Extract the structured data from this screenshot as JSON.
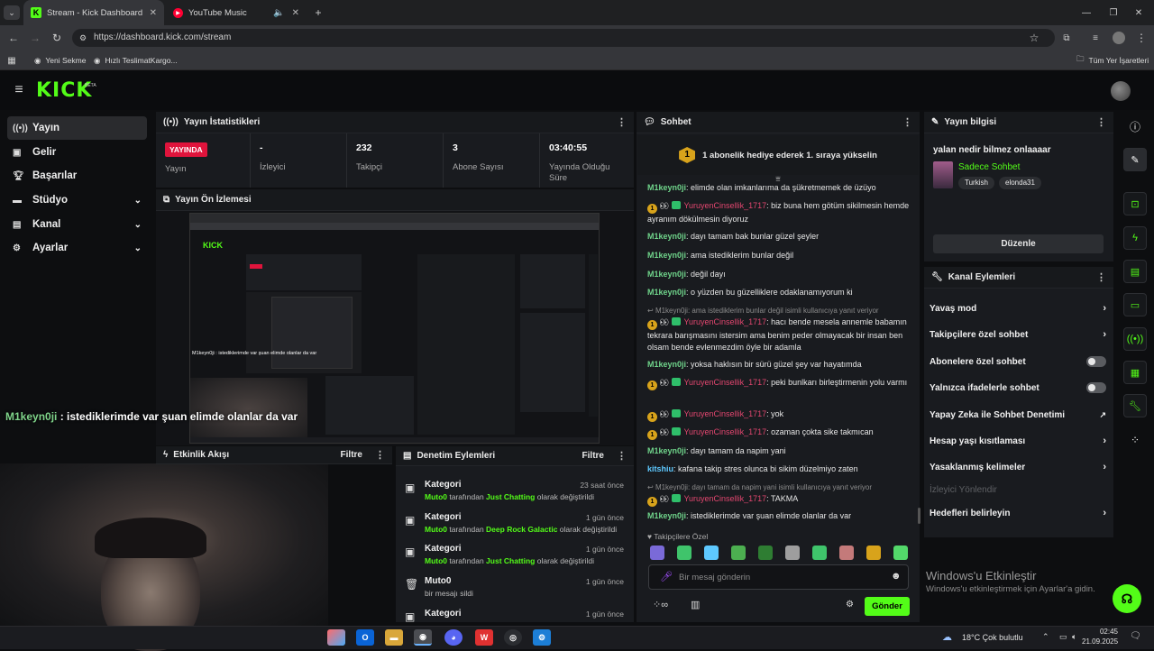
{
  "browser": {
    "tabs": [
      {
        "title": "Stream - Kick Dashboard"
      },
      {
        "title": "YouTube Music"
      }
    ],
    "url": "https://dashboard.kick.com/stream",
    "bookmarks": [
      "Yeni Sekme",
      "Hızlı TeslimatKargo...",
      "Tüm Yer İşaretleri"
    ]
  },
  "sidebar": {
    "items": [
      {
        "label": "Yayın",
        "icon": "broadcast-icon"
      },
      {
        "label": "Gelir",
        "icon": "revenue-icon"
      },
      {
        "label": "Başarılar",
        "icon": "trophy-icon"
      },
      {
        "label": "Stüdyo",
        "icon": "studio-icon"
      },
      {
        "label": "Kanal",
        "icon": "channel-icon"
      },
      {
        "label": "Ayarlar",
        "icon": "gear-icon"
      }
    ]
  },
  "stats": {
    "title": "Yayın İstatistikleri",
    "live": "YAYINDA",
    "live_label": "Yayın",
    "viewers_value": "-",
    "viewers_label": "İzleyici",
    "followers_value": "232",
    "followers_label": "Takipçi",
    "subs_value": "3",
    "subs_label": "Abone Sayısı",
    "uptime_value": "03:40:55",
    "uptime_label": "Yayında Olduğu Süre"
  },
  "preview": {
    "title": "Yayın Ön İzlemesi"
  },
  "overlay_chat": {
    "user": "M1keyn0ji",
    "text": " : istediklerimde var şuan elimde olanlar da var"
  },
  "activity": {
    "title": "Etkinlik Akışı",
    "filter": "Filtre"
  },
  "moderation": {
    "title": "Denetim Eylemleri",
    "filter": "Filtre",
    "items": [
      {
        "title": "Kategori",
        "time": "23 saat önce",
        "user": "Muto0",
        "mid": " tarafından ",
        "target": "Just Chatting",
        "end": " olarak değiştirildi"
      },
      {
        "title": "Kategori",
        "time": "1 gün önce",
        "user": "Muto0",
        "mid": " tarafından ",
        "target": "Deep Rock Galactic",
        "end": " olarak değiştirildi"
      },
      {
        "title": "Kategori",
        "time": "1 gün önce",
        "user": "Muto0",
        "mid": " tarafından ",
        "target": "Just Chatting",
        "end": " olarak değiştirildi"
      },
      {
        "title": "Muto0",
        "time": "1 gün önce",
        "user": "",
        "mid": "bir mesajı sildi",
        "target": "",
        "end": ""
      },
      {
        "title": "Kategori",
        "time": "1 gün önce",
        "user": "",
        "mid": "",
        "target": "",
        "end": ""
      }
    ]
  },
  "chat": {
    "title": "Sohbet",
    "pinned_badge": "1",
    "pinned": "1 abonelik hediye ederek 1. sıraya yükselin",
    "messages": [
      {
        "user": "M1keyn0ji",
        "text": "elimde olan imkanlarıma da şükretmemek de üzüyo"
      },
      {
        "user": "YuruyenCinsellik_1717",
        "text": "biz buna hem götüm sikilmesin hemde ayranım dökülmesin diyoruz"
      },
      {
        "user": "M1keyn0ji",
        "text": "dayı tamam bak bunlar güzel şeyler"
      },
      {
        "user": "M1keyn0ji",
        "text": "ama istediklerim bunlar değil"
      },
      {
        "user": "M1keyn0ji",
        "text": "değil dayı"
      },
      {
        "user": "M1keyn0ji",
        "text": "o yüzden bu güzelliklere odaklanamıyorum ki"
      },
      {
        "reply": "M1keyn0ji: ama istediklerim bunlar değil isimli kullanıcıya yanıt veriyor",
        "user": "YuruyenCinsellik_1717",
        "text": "hacı bende mesela annemle babamın tekrara barışmasını istersim ama benim peder olmayacak bir insan ben olsam bende evlenmezdim öyle bir adamla"
      },
      {
        "user": "M1keyn0ji",
        "text": "yoksa haklısın bir sürü güzel şey var hayatımda"
      },
      {
        "user": "YuruyenCinsellik_1717",
        "text": "peki bunlkarı birleştirmenin yolu varmı"
      },
      {
        "user": "YuruyenCinsellik_1717",
        "text": "yok"
      },
      {
        "user": "YuruyenCinsellik_1717",
        "text": "ozaman çokta sike takmıcan"
      },
      {
        "user": "M1keyn0ji",
        "text": "dayı tamam da napim yani"
      },
      {
        "user": "kitshiu",
        "text": "kafana takip stres olunca bi sikim düzelmiyo zaten"
      },
      {
        "reply": "M1keyn0ji: dayı tamam da napim yani isimli kullanıcıya yanıt veriyor",
        "user": "YuruyenCinsellik_1717",
        "text": "TAKMA"
      },
      {
        "user": "M1keyn0ji",
        "text": "istediklerimde var şuan elimde olanlar da var"
      }
    ],
    "followers_only": "Takipçilere Özel",
    "input_placeholder": "Bir mesaj gönderin",
    "send": "Gönder"
  },
  "stream_info": {
    "title": "Yayın bilgisi",
    "stream_title": "yalan nedir bilmez onlaaaar",
    "category": "Sadece Sohbet",
    "tags": [
      "Turkish",
      "elonda31"
    ],
    "edit": "Düzenle"
  },
  "channel_actions": {
    "title": "Kanal Eylemleri",
    "items": [
      {
        "label": "Yavaş mod",
        "kind": "chevron"
      },
      {
        "label": "Takipçilere özel sohbet",
        "kind": "chevron"
      },
      {
        "label": "Abonelere özel sohbet",
        "kind": "toggle"
      },
      {
        "label": "Yalnızca ifadelerle sohbet",
        "kind": "toggle"
      },
      {
        "label": "Yapay Zeka ile Sohbet Denetimi",
        "kind": "external"
      },
      {
        "label": "Hesap yaşı kısıtlaması",
        "kind": "chevron"
      },
      {
        "label": "Yasaklanmış kelimeler",
        "kind": "chevron"
      },
      {
        "label": "İzleyici Yönlendir",
        "kind": "disabled"
      },
      {
        "label": "Hedefleri belirleyin",
        "kind": "chevron"
      }
    ]
  },
  "windows": {
    "activate_title": "Windows'u Etkinleştir",
    "activate_sub": "Windows'u etkinleştirmek için Ayarlar'a gidin.",
    "weather": "18°C  Çok bulutlu",
    "time": "02:45",
    "date": "21.09.2025"
  },
  "colors": {
    "kick_green": "#53fc18",
    "live_red": "#e0143c",
    "panel": "#191b1f"
  }
}
